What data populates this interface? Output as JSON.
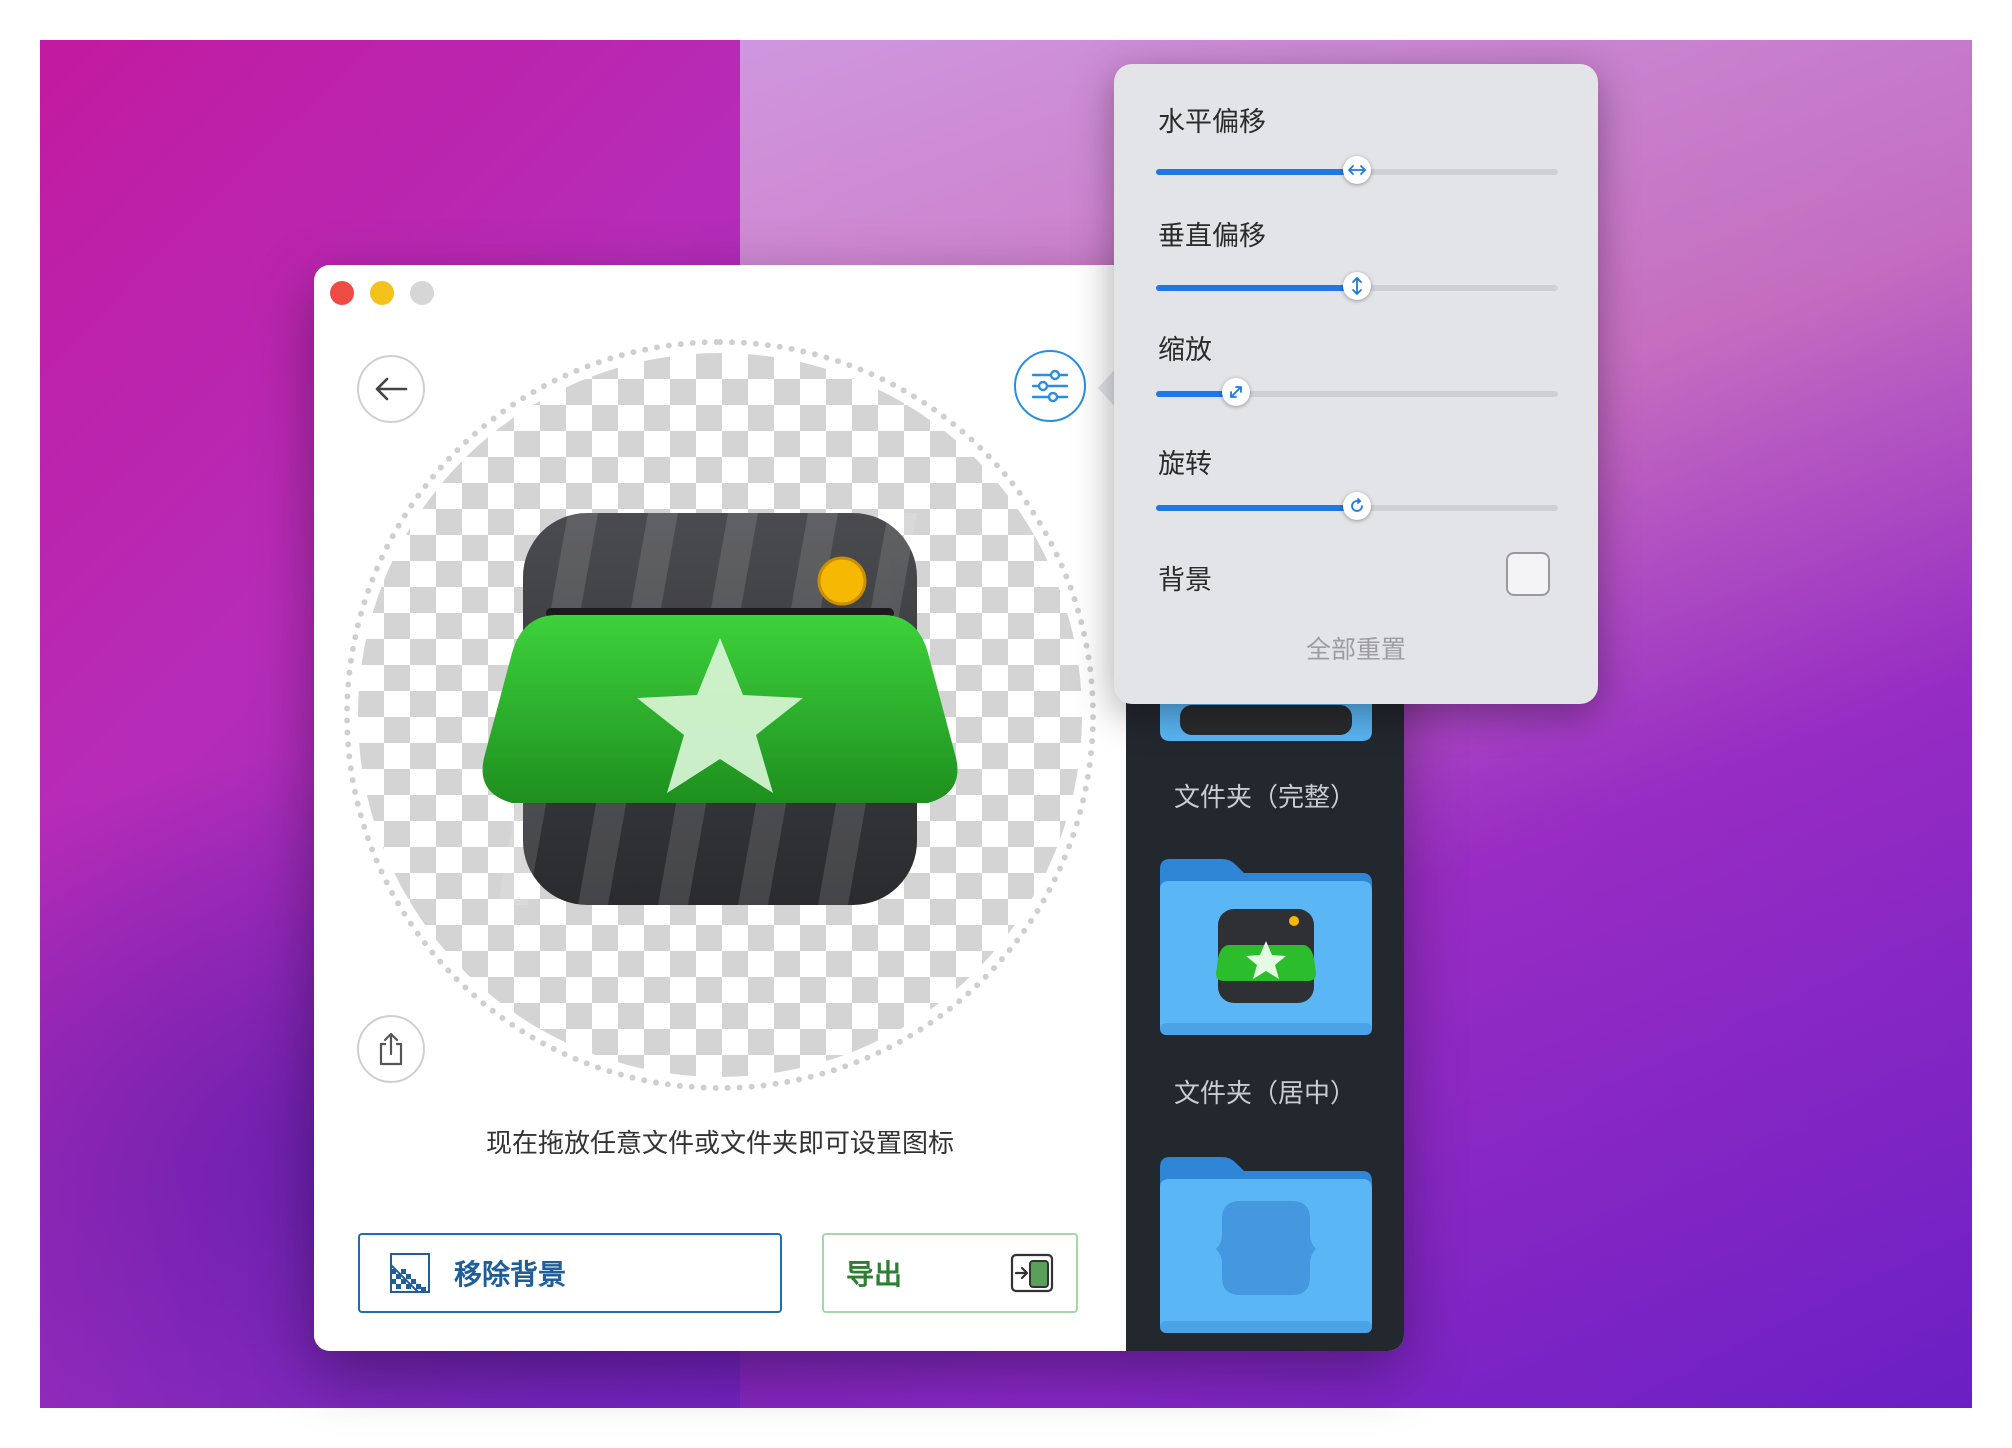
{
  "editor": {
    "hint_text": "现在拖放任意文件或文件夹即可设置图标",
    "remove_bg_label": "移除背景",
    "export_label": "导出"
  },
  "sidebar": {
    "folders": [
      {
        "caption": "文件夹（完整）"
      },
      {
        "caption": "文件夹（居中）"
      },
      {
        "caption": ""
      }
    ]
  },
  "popover": {
    "sliders": [
      {
        "label": "水平偏移",
        "value": 0.5,
        "icon": "horizontal-arrows-icon"
      },
      {
        "label": "垂直偏移",
        "value": 0.5,
        "icon": "vertical-arrows-icon"
      },
      {
        "label": "缩放",
        "value": 0.2,
        "icon": "diagonal-arrows-icon"
      },
      {
        "label": "旋转",
        "value": 0.5,
        "icon": "rotate-icon"
      }
    ],
    "background_label": "背景",
    "background_checked": false,
    "reset_all_label": "全部重置"
  },
  "colors": {
    "accent": "#1f78e6",
    "remove_bg": "#1f5e98",
    "export": "#2e7d32",
    "folder": "#5ab6f5"
  }
}
